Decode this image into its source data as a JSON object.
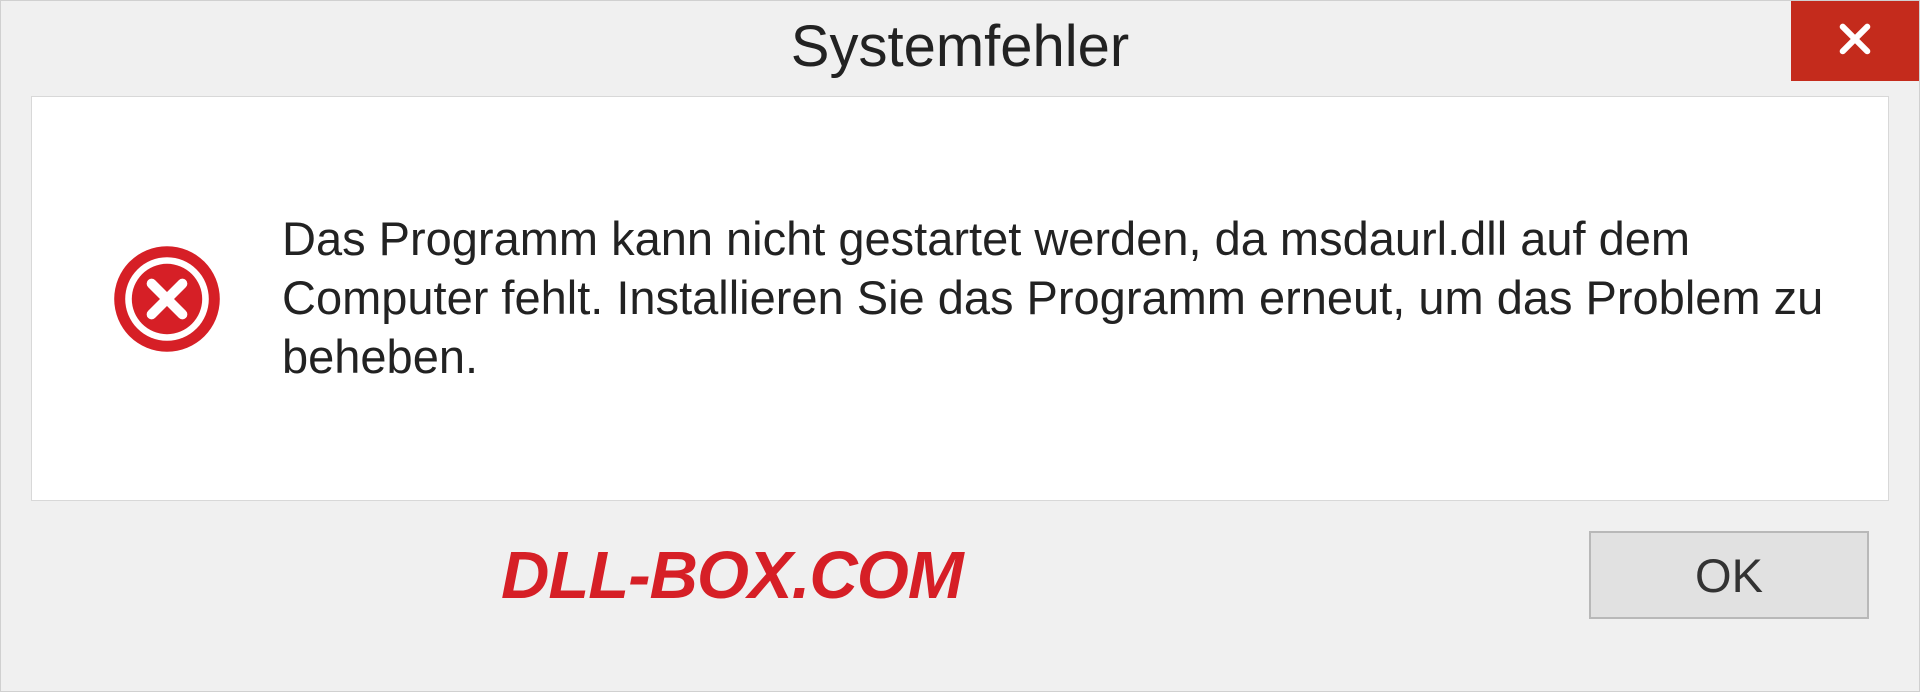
{
  "dialog": {
    "title": "Systemfehler",
    "message": "Das Programm kann nicht gestartet werden, da msdaurl.dll auf dem Computer fehlt. Installieren Sie das Programm erneut, um das Problem zu beheben.",
    "ok_label": "OK"
  },
  "watermark": "DLL-BOX.COM"
}
